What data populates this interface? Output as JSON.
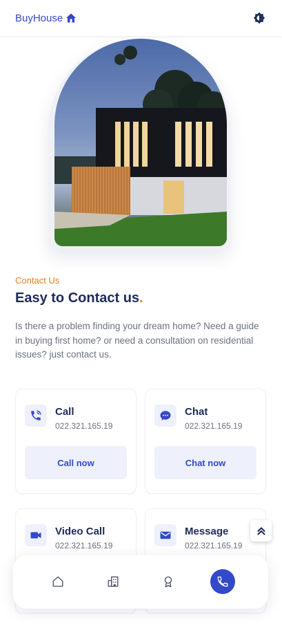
{
  "header": {
    "logo_text": "BuyHouse",
    "logo_icon": "house-icon",
    "theme_icon": "theme-toggle-icon"
  },
  "contact": {
    "subtitle": "Contact Us",
    "title": "Easy to Contact us",
    "title_dot": ".",
    "description": "Is there a problem finding your dream home? Need a guide in buying first home? or need a consultation on residential issues? just contact us."
  },
  "cards": [
    {
      "title": "Call",
      "number": "022.321.165.19",
      "button": "Call now",
      "icon": "phone-icon"
    },
    {
      "title": "Chat",
      "number": "022.321.165.19",
      "button": "Chat now",
      "icon": "chat-icon"
    },
    {
      "title": "Video Call",
      "number": "022.321.165.19",
      "icon": "video-icon"
    },
    {
      "title": "Message",
      "number": "022.321.165.19",
      "icon": "mail-icon"
    }
  ],
  "nav": {
    "items": [
      {
        "icon": "home-icon",
        "active": false
      },
      {
        "icon": "building-icon",
        "active": false
      },
      {
        "icon": "award-icon",
        "active": false
      },
      {
        "icon": "phone-icon",
        "active": true
      }
    ]
  },
  "colors": {
    "primary": "#3349c9",
    "accent": "#e67e22",
    "heading": "#1e2a5a",
    "text": "#6b7185",
    "tint": "#eef1fc"
  }
}
